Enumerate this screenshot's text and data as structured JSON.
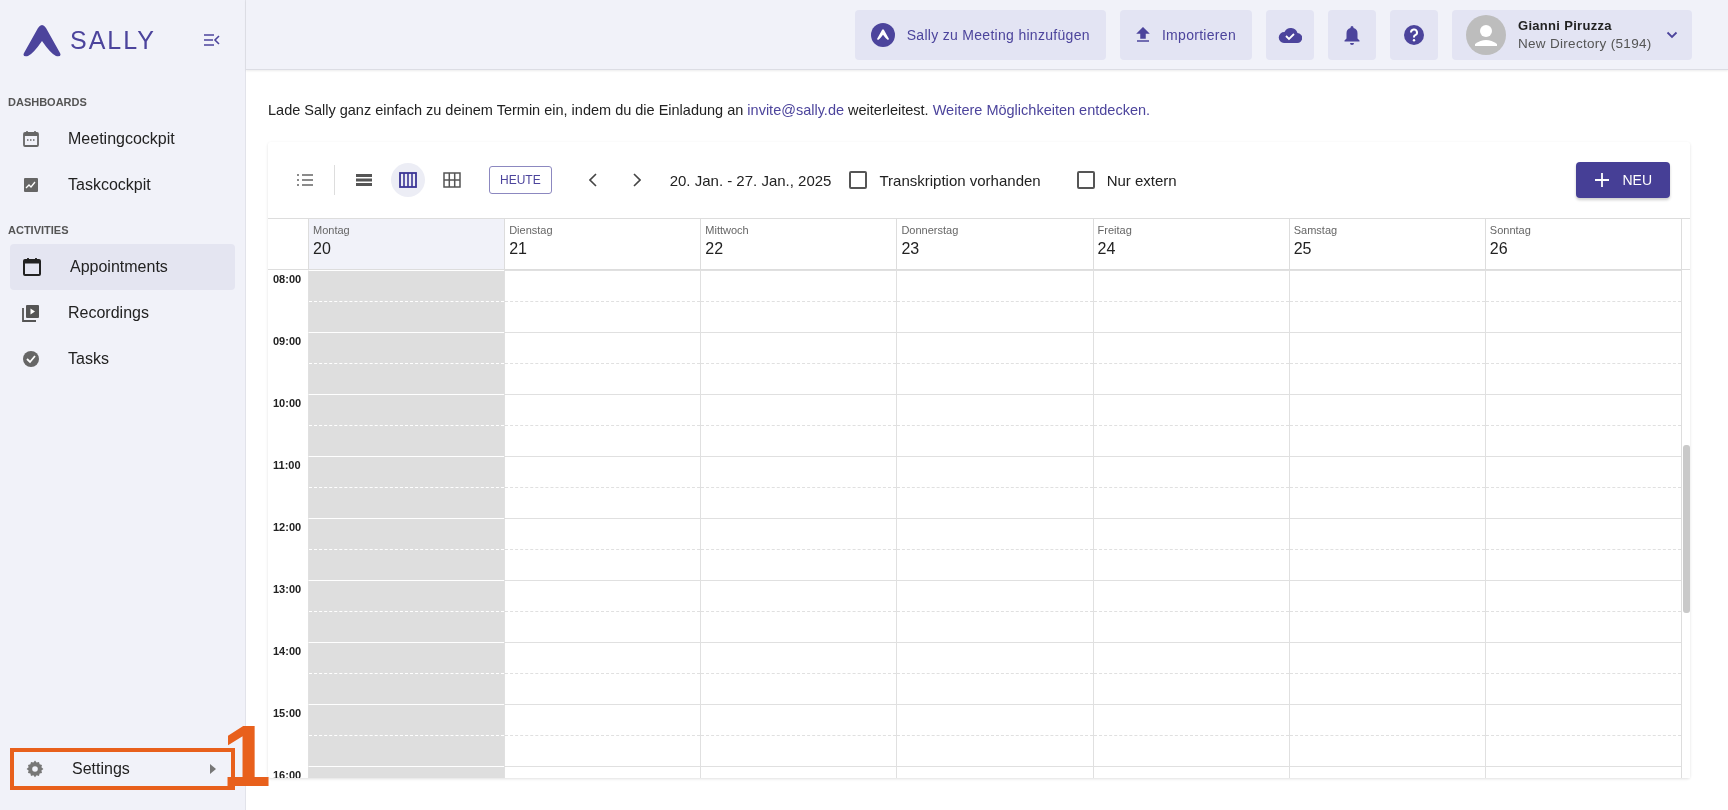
{
  "sidebar": {
    "logo": "SALLY",
    "sections": [
      {
        "title": "DASHBOARDS",
        "items": [
          {
            "label": "Meetingcockpit",
            "selected": false
          },
          {
            "label": "Taskcockpit",
            "selected": false
          }
        ]
      },
      {
        "title": "ACTIVITIES",
        "items": [
          {
            "label": "Appointments",
            "selected": true
          },
          {
            "label": "Recordings",
            "selected": false
          },
          {
            "label": "Tasks",
            "selected": false
          }
        ]
      }
    ],
    "settings": {
      "label": "Settings",
      "highlighted": true
    }
  },
  "annotation": {
    "label": "1"
  },
  "topbar": {
    "buttons": [
      {
        "kind": "sally",
        "label": "Sally zu Meeting hinzufügen"
      },
      {
        "kind": "upload",
        "label": "Importieren"
      },
      {
        "kind": "cloud"
      },
      {
        "kind": "bell"
      },
      {
        "kind": "help"
      }
    ],
    "user": {
      "name": "Gianni Piruzza",
      "directory": "New Directory (5194)"
    }
  },
  "info": [
    {
      "kind": "text",
      "text": "Lade Sally ganz einfach zu deinem Termin ein, indem du die Einladung an "
    },
    {
      "kind": "link",
      "text": "invite@sally.de"
    },
    {
      "kind": "text",
      "text": " weiterleitest. "
    },
    {
      "kind": "link",
      "text": "Weitere Möglichkeiten entdecken."
    }
  ],
  "toolbar": {
    "views": [
      {
        "kind": "list",
        "selected": false
      },
      {
        "kind": "day",
        "selected": false
      },
      {
        "kind": "week",
        "selected": true
      },
      {
        "kind": "month",
        "selected": false
      }
    ],
    "today": "HEUTE",
    "range": "20. Jan. - 27. Jan., 2025",
    "filters": [
      {
        "label": "Transkription vorhanden",
        "checked": false
      },
      {
        "label": "Nur extern",
        "checked": false
      }
    ],
    "new_button": "NEU"
  },
  "days": [
    {
      "name": "Montag",
      "date": "20",
      "past": true,
      "selected": true
    },
    {
      "name": "Dienstag",
      "date": "21",
      "past": false,
      "selected": false
    },
    {
      "name": "Mittwoch",
      "date": "22",
      "past": false,
      "selected": false
    },
    {
      "name": "Donnerstag",
      "date": "23",
      "past": false,
      "selected": false
    },
    {
      "name": "Freitag",
      "date": "24",
      "past": false,
      "selected": false
    },
    {
      "name": "Samstag",
      "date": "25",
      "past": false,
      "selected": false
    },
    {
      "name": "Sonntag",
      "date": "26",
      "past": false,
      "selected": false
    }
  ],
  "times": [
    "08:00",
    "09:00",
    "10:00",
    "11:00",
    "12:00",
    "13:00",
    "14:00",
    "15:00",
    "16:00"
  ]
}
